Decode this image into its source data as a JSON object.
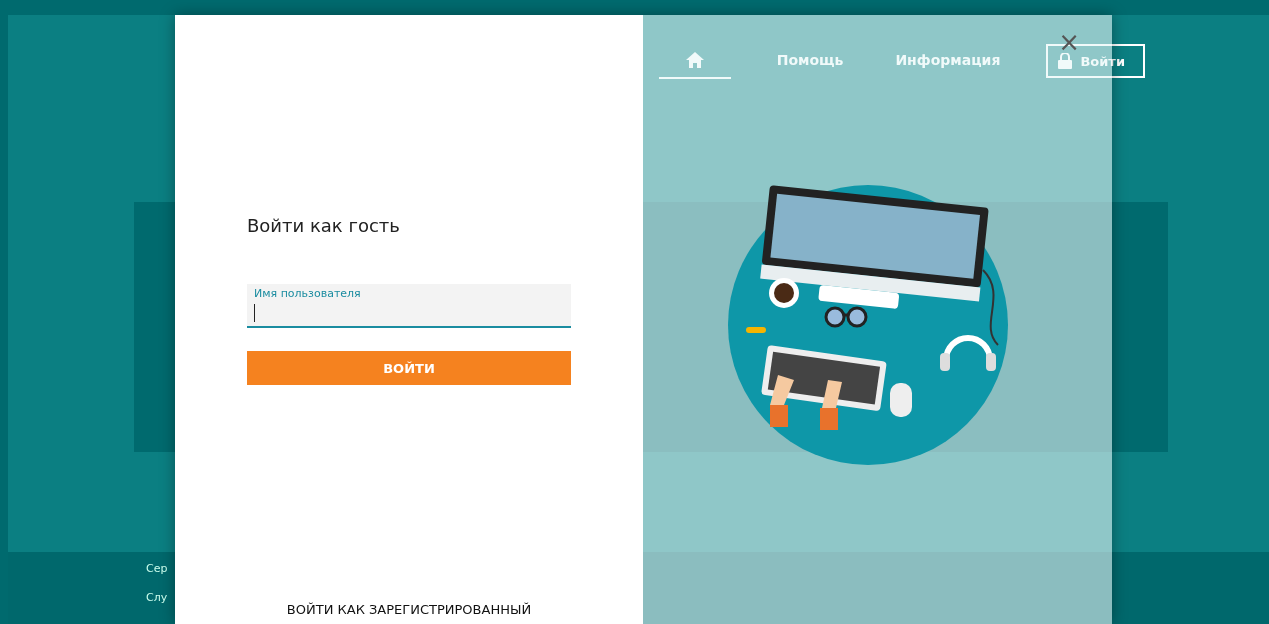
{
  "nav": {
    "items": [
      {
        "kind": "home",
        "selected": true
      },
      {
        "kind": "link",
        "label": "Помощь",
        "selected": false
      },
      {
        "kind": "link",
        "label": "Информация",
        "selected": false
      }
    ],
    "login_button": "Войти"
  },
  "footer": {
    "lines": [
      "Сер",
      "Слу"
    ]
  },
  "dialog": {
    "title": "Войти как гость",
    "username_field": {
      "label": "Имя пользователя",
      "focused": true
    },
    "submit_button": "ВОЙТИ",
    "switch_link": "ВОЙТИ КАК ЗАРЕГИСТРИРОВАННЫЙ",
    "close": "×"
  }
}
